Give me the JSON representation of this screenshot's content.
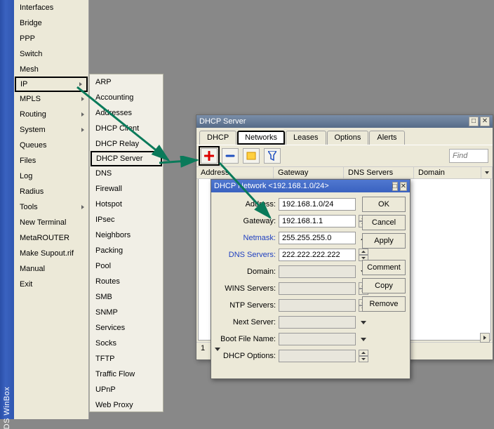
{
  "vbar": {
    "label": "DS WinBox"
  },
  "menu1": {
    "items": [
      {
        "label": "Interfaces",
        "arrow": false
      },
      {
        "label": "Bridge",
        "arrow": false
      },
      {
        "label": "PPP",
        "arrow": false
      },
      {
        "label": "Switch",
        "arrow": false
      },
      {
        "label": "Mesh",
        "arrow": false
      },
      {
        "label": "IP",
        "arrow": true,
        "highlight": true
      },
      {
        "label": "MPLS",
        "arrow": true
      },
      {
        "label": "Routing",
        "arrow": true
      },
      {
        "label": "System",
        "arrow": true
      },
      {
        "label": "Queues",
        "arrow": false
      },
      {
        "label": "Files",
        "arrow": false
      },
      {
        "label": "Log",
        "arrow": false
      },
      {
        "label": "Radius",
        "arrow": false
      },
      {
        "label": "Tools",
        "arrow": true
      },
      {
        "label": "New Terminal",
        "arrow": false
      },
      {
        "label": "MetaROUTER",
        "arrow": false
      },
      {
        "label": "Make Supout.rif",
        "arrow": false
      },
      {
        "label": "Manual",
        "arrow": false
      },
      {
        "label": "Exit",
        "arrow": false
      }
    ]
  },
  "menu2": {
    "items": [
      {
        "label": "ARP"
      },
      {
        "label": "Accounting"
      },
      {
        "label": "Addresses"
      },
      {
        "label": "DHCP Client"
      },
      {
        "label": "DHCP Relay"
      },
      {
        "label": "DHCP Server",
        "highlight": true
      },
      {
        "label": "DNS"
      },
      {
        "label": "Firewall"
      },
      {
        "label": "Hotspot"
      },
      {
        "label": "IPsec"
      },
      {
        "label": "Neighbors"
      },
      {
        "label": "Packing"
      },
      {
        "label": "Pool"
      },
      {
        "label": "Routes"
      },
      {
        "label": "SMB"
      },
      {
        "label": "SNMP"
      },
      {
        "label": "Services"
      },
      {
        "label": "Socks"
      },
      {
        "label": "TFTP"
      },
      {
        "label": "Traffic Flow"
      },
      {
        "label": "UPnP"
      },
      {
        "label": "Web Proxy"
      }
    ]
  },
  "dhcp_win": {
    "title": "DHCP Server",
    "tabs": [
      "DHCP",
      "Networks",
      "Leases",
      "Options",
      "Alerts"
    ],
    "find_placeholder": "Find",
    "columns": [
      "Address",
      "Gateway",
      "DNS Servers",
      "Domain"
    ],
    "status": "1"
  },
  "net_win": {
    "title": "DHCP Network <192.168.1.0/24>",
    "fields": {
      "address_lbl": "Address:",
      "address": "192.168.1.0/24",
      "gateway_lbl": "Gateway:",
      "gateway": "192.168.1.1",
      "netmask_lbl": "Netmask:",
      "netmask": "255.255.255.0",
      "dns_lbl": "DNS Servers:",
      "dns": "222.222.222.222",
      "domain_lbl": "Domain:",
      "wins_lbl": "WINS Servers:",
      "ntp_lbl": "NTP Servers:",
      "next_lbl": "Next Server:",
      "boot_lbl": "Boot File Name:",
      "dhcpopt_lbl": "DHCP Options:"
    },
    "buttons": {
      "ok": "OK",
      "cancel": "Cancel",
      "apply": "Apply",
      "comment": "Comment",
      "copy": "Copy",
      "remove": "Remove"
    }
  }
}
